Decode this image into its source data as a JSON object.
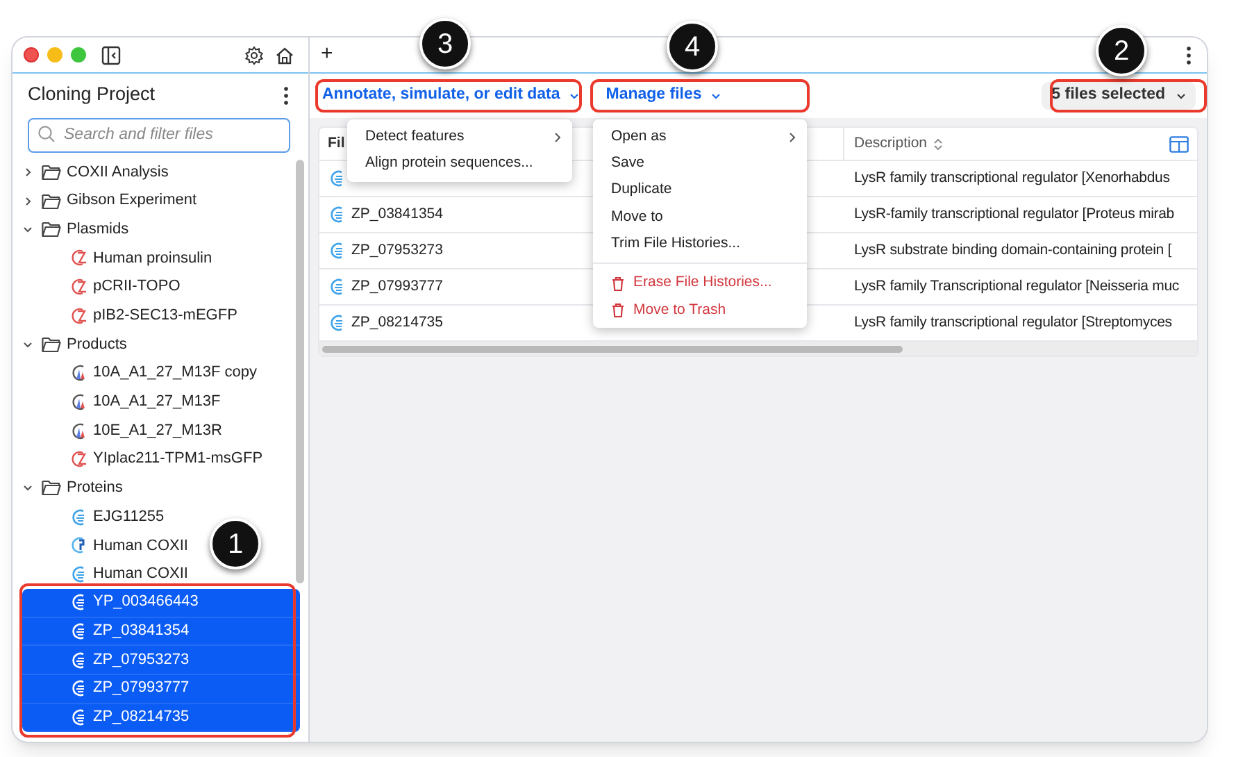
{
  "sidebar": {
    "title": "Cloning Project",
    "search": {
      "placeholder": "Search and filter files"
    },
    "tree": [
      {
        "label": "COXII Analysis",
        "kind": "folder",
        "expanded": false,
        "selected": false
      },
      {
        "label": "Gibson Experiment",
        "kind": "folder",
        "expanded": false,
        "selected": false
      },
      {
        "label": "Plasmids",
        "kind": "folder",
        "expanded": true,
        "selected": false,
        "children": [
          {
            "label": "Human proinsulin",
            "kind": "plasmid",
            "selected": false
          },
          {
            "label": "pCRII-TOPO",
            "kind": "plasmid",
            "selected": false
          },
          {
            "label": "pIB2-SEC13-mEGFP",
            "kind": "plasmid",
            "selected": false
          }
        ]
      },
      {
        "label": "Products",
        "kind": "folder",
        "expanded": true,
        "selected": false,
        "children": [
          {
            "label": "10A_A1_27_M13F copy",
            "kind": "trace",
            "selected": false
          },
          {
            "label": "10A_A1_27_M13F",
            "kind": "trace",
            "selected": false
          },
          {
            "label": "10E_A1_27_M13R",
            "kind": "trace",
            "selected": false
          },
          {
            "label": "YIplac211-TPM1-msGFP",
            "kind": "plasmid",
            "selected": false
          }
        ]
      },
      {
        "label": "Proteins",
        "kind": "folder",
        "expanded": true,
        "selected": false,
        "children": [
          {
            "label": "EJG11255",
            "kind": "protein",
            "selected": false
          },
          {
            "label": "Human COXII",
            "kind": "structure",
            "selected": false
          },
          {
            "label": "Human COXII",
            "kind": "protein",
            "selected": false
          },
          {
            "label": "YP_003466443",
            "kind": "protein",
            "selected": true
          },
          {
            "label": "ZP_03841354",
            "kind": "protein",
            "selected": true
          },
          {
            "label": "ZP_07953273",
            "kind": "protein",
            "selected": true
          },
          {
            "label": "ZP_07993777",
            "kind": "protein",
            "selected": true
          },
          {
            "label": "ZP_08214735",
            "kind": "protein",
            "selected": true
          }
        ]
      }
    ]
  },
  "tab_bar": {
    "new_tab": "+"
  },
  "toolbar": {
    "menus": [
      {
        "label": "Annotate, simulate, or edit data",
        "open": true
      },
      {
        "label": "Manage files",
        "open": true
      }
    ],
    "selection": "5 files selected"
  },
  "annotate_menu": [
    {
      "label": "Detect features",
      "kind": "submenu"
    },
    {
      "label": "Align protein sequences...",
      "kind": "item"
    }
  ],
  "manage_menu": [
    {
      "label": "Open as",
      "kind": "submenu"
    },
    {
      "label": "Save",
      "kind": "item"
    },
    {
      "label": "Duplicate",
      "kind": "item"
    },
    {
      "label": "Move to",
      "kind": "item"
    },
    {
      "label": "Trim File Histories...",
      "kind": "item"
    },
    {
      "kind": "divider"
    },
    {
      "label": "Erase File Histories...",
      "kind": "danger"
    },
    {
      "label": "Move to Trash",
      "kind": "danger"
    }
  ],
  "table": {
    "columns": [
      "Fil",
      "Description"
    ],
    "rows": [
      {
        "description": "LysR family transcriptional regulator [Xenorhabdus"
      },
      {
        "name": "ZP_03841354",
        "description": "LysR-family transcriptional regulator [Proteus mirab"
      },
      {
        "name": "ZP_07953273",
        "description": "LysR substrate binding domain-containing protein ["
      },
      {
        "name": "ZP_07993777",
        "description": "LysR family Transcriptional regulator [Neisseria muc"
      },
      {
        "name": "ZP_08214735",
        "description": "LysR family transcriptional regulator [Streptomyces"
      }
    ]
  },
  "callouts": [
    "3",
    "4",
    "2",
    "1"
  ]
}
